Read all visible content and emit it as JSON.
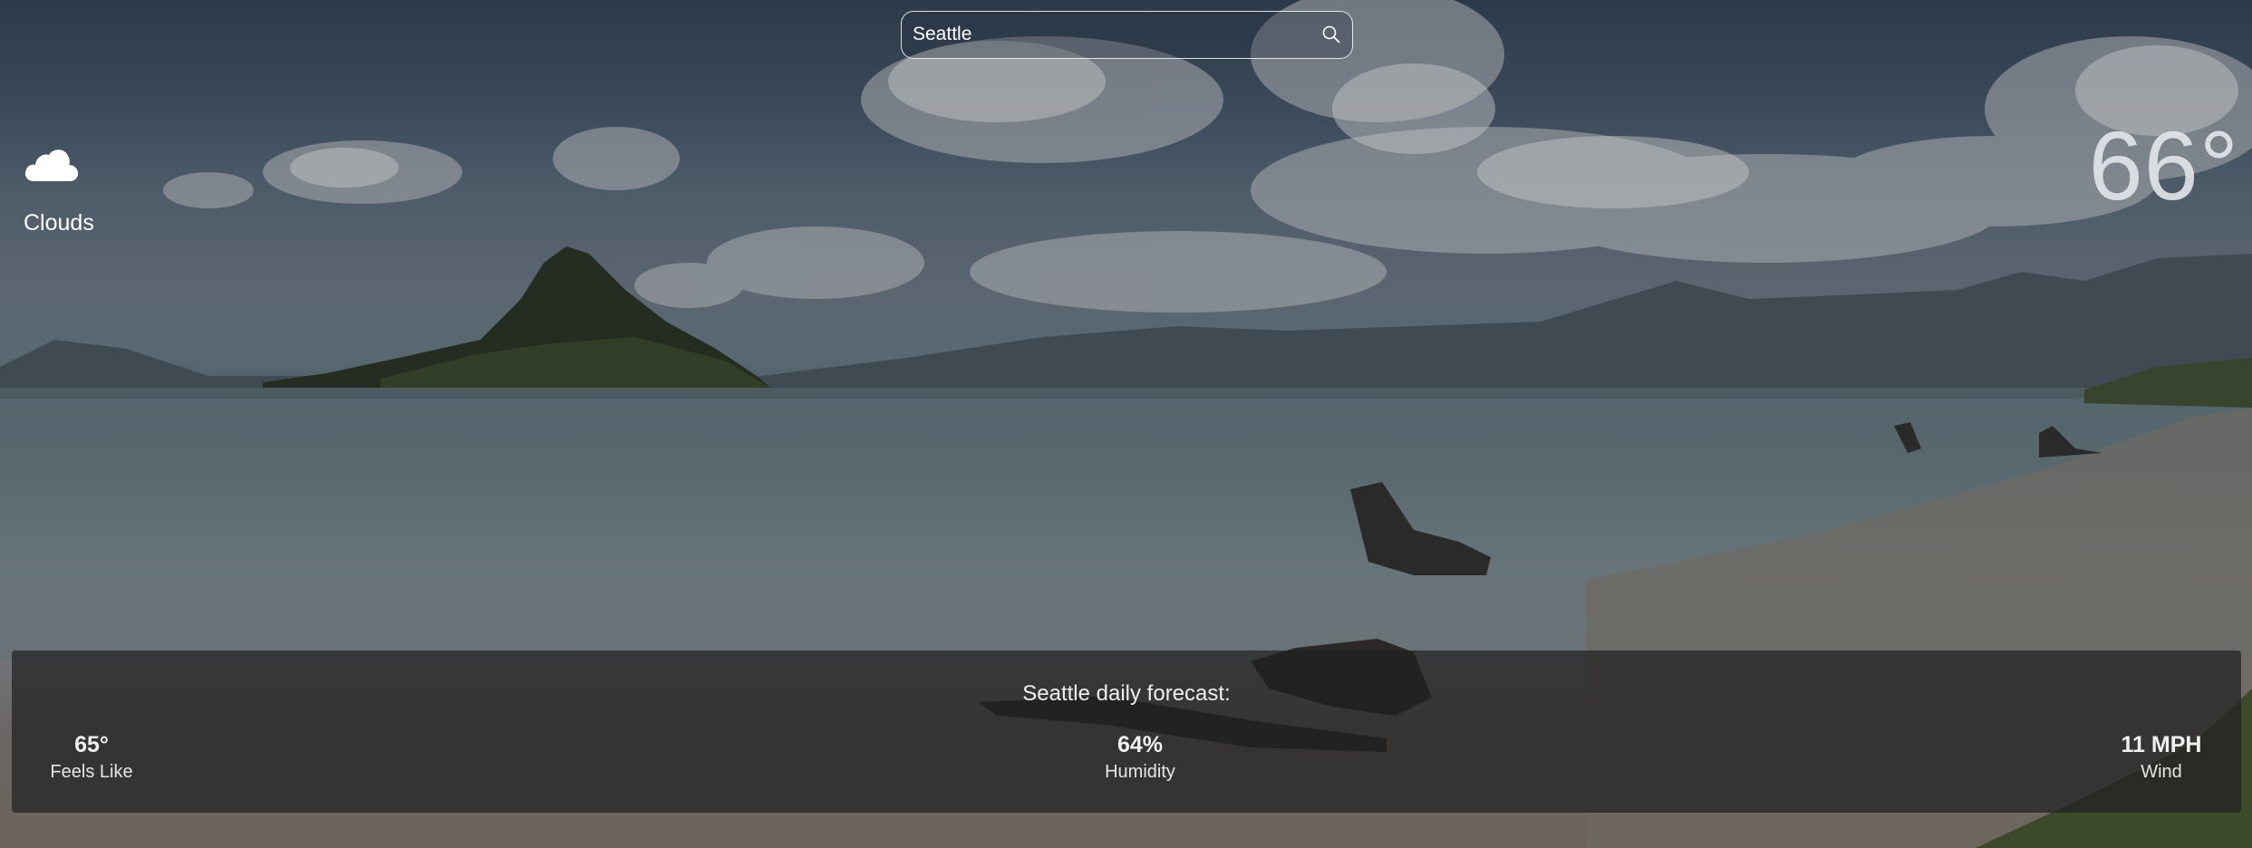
{
  "search": {
    "value": "Seattle",
    "icon": "search-icon"
  },
  "current": {
    "icon": "cloud-icon",
    "condition": "Clouds",
    "temperature": "66°"
  },
  "forecast": {
    "title": "Seattle daily forecast:",
    "feels_like": {
      "value": "65°",
      "label": "Feels Like"
    },
    "humidity": {
      "value": "64%",
      "label": "Humidity"
    },
    "wind": {
      "value": "11 MPH",
      "label": "Wind"
    }
  }
}
